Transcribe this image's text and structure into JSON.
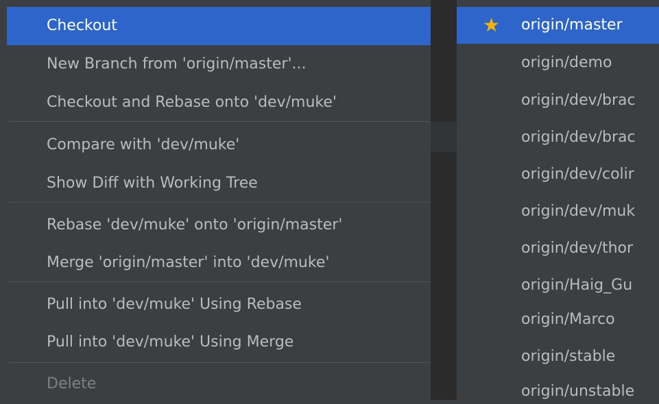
{
  "context_menu": {
    "items": [
      {
        "label": "Checkout"
      },
      {
        "label": "New Branch from 'origin/master'..."
      },
      {
        "label": "Checkout and Rebase onto 'dev/muke'"
      },
      {
        "label": "Compare with 'dev/muke'"
      },
      {
        "label": "Show Diff with Working Tree"
      },
      {
        "label": "Rebase 'dev/muke' onto 'origin/master'"
      },
      {
        "label": "Merge 'origin/master' into 'dev/muke'"
      },
      {
        "label": "Pull into 'dev/muke' Using Rebase"
      },
      {
        "label": "Pull into 'dev/muke' Using Merge"
      },
      {
        "label": "Delete"
      }
    ]
  },
  "branch_list": {
    "favorite_icon": "star-icon",
    "items": [
      {
        "label": "origin/master"
      },
      {
        "label": "origin/demo"
      },
      {
        "label": "origin/dev/brac"
      },
      {
        "label": "origin/dev/brac"
      },
      {
        "label": "origin/dev/colir"
      },
      {
        "label": "origin/dev/muk"
      },
      {
        "label": "origin/dev/thor"
      },
      {
        "label": "origin/Haig_Gu"
      },
      {
        "label": "origin/Marco"
      },
      {
        "label": "origin/stable"
      },
      {
        "label": "origin/unstable"
      }
    ]
  },
  "colors": {
    "selection": "#2e65ca",
    "menu_background": "#3c3f41",
    "text": "#bbbbbb",
    "disabled_text": "#808080",
    "star": "#f4b400"
  }
}
